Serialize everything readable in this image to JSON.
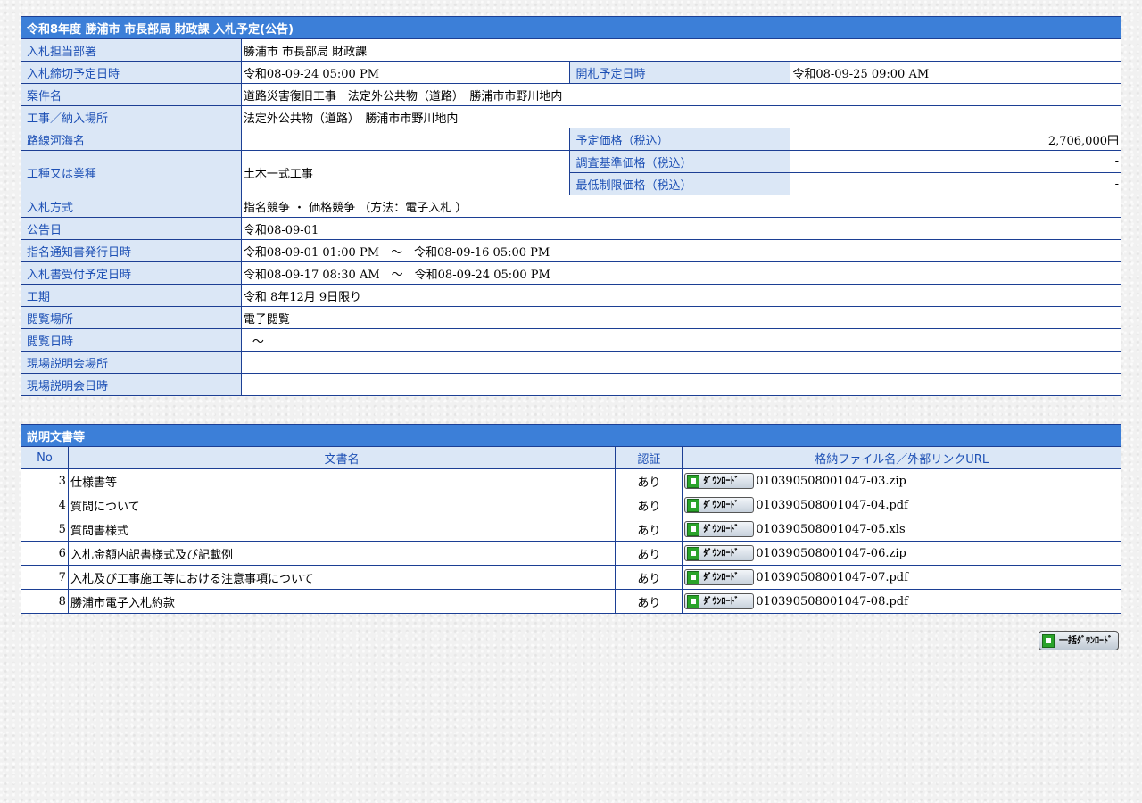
{
  "notice": {
    "title": "令和8年度 勝浦市 市長部局 財政課 入札予定(公告)",
    "rows": {
      "department": {
        "label": "入札担当部署",
        "value": "勝浦市 市長部局 財政課"
      },
      "deadline": {
        "label": "入札締切予定日時",
        "value": "令和08-09-24 05:00 PM",
        "label2": "開札予定日時",
        "value2": "令和08-09-25 09:00 AM"
      },
      "case_name": {
        "label": "案件名",
        "value": "道路災害復旧工事　法定外公共物（道路）　勝浦市市野川地内"
      },
      "location": {
        "label": "工事／納入場所",
        "value": "法定外公共物（道路）　勝浦市市野川地内"
      },
      "route": {
        "label": "路線河海名",
        "value": "",
        "label2": "予定価格（税込）",
        "value2": "2,706,000円"
      },
      "work_type": {
        "label": "工種又は業種",
        "value": "土木一式工事",
        "label2": "調査基準価格（税込）",
        "value2": "-",
        "label3": "最低制限価格（税込）",
        "value3": "-"
      },
      "method": {
        "label": "入札方式",
        "value": "指名競争 ・ 価格競争 （方法：電子入札 ）"
      },
      "announce": {
        "label": "公告日",
        "value": "令和08-09-01"
      },
      "notify": {
        "label": "指名通知書発行日時",
        "value": "令和08-09-01 01:00 PM　～　令和08-09-16 05:00 PM"
      },
      "receipt": {
        "label": "入札書受付予定日時",
        "value": "令和08-09-17 08:30 AM　～　令和08-09-24 05:00 PM"
      },
      "period": {
        "label": "工期",
        "value": "令和 8年12月 9日限り"
      },
      "view_place": {
        "label": "閲覧場所",
        "value": "電子閲覧"
      },
      "view_time": {
        "label": "閲覧日時",
        "value": "～"
      },
      "site_place": {
        "label": "現場説明会場所",
        "value": ""
      },
      "site_time": {
        "label": "現場説明会日時",
        "value": ""
      }
    }
  },
  "docs": {
    "title": "説明文書等",
    "headers": {
      "no": "No",
      "name": "文書名",
      "auth": "認証",
      "file": "格納ファイル名／外部リンクURL"
    },
    "download_label": "ﾀﾞｳﾝﾛｰﾄﾞ",
    "items": [
      {
        "no": "3",
        "name": "仕様書等",
        "auth": "あり",
        "file": "010390508001047-03.zip"
      },
      {
        "no": "4",
        "name": "質問について",
        "auth": "あり",
        "file": "010390508001047-04.pdf"
      },
      {
        "no": "5",
        "name": "質問書様式",
        "auth": "あり",
        "file": "010390508001047-05.xls"
      },
      {
        "no": "6",
        "name": "入札金額内訳書様式及び記載例",
        "auth": "あり",
        "file": "010390508001047-06.zip"
      },
      {
        "no": "7",
        "name": "入札及び工事施工等における注意事項について",
        "auth": "あり",
        "file": "010390508001047-07.pdf"
      },
      {
        "no": "8",
        "name": "勝浦市電子入札約款",
        "auth": "あり",
        "file": "010390508001047-08.pdf"
      }
    ],
    "bulk_label": "一括ﾀﾞｳﾝﾛｰﾄﾞ"
  }
}
